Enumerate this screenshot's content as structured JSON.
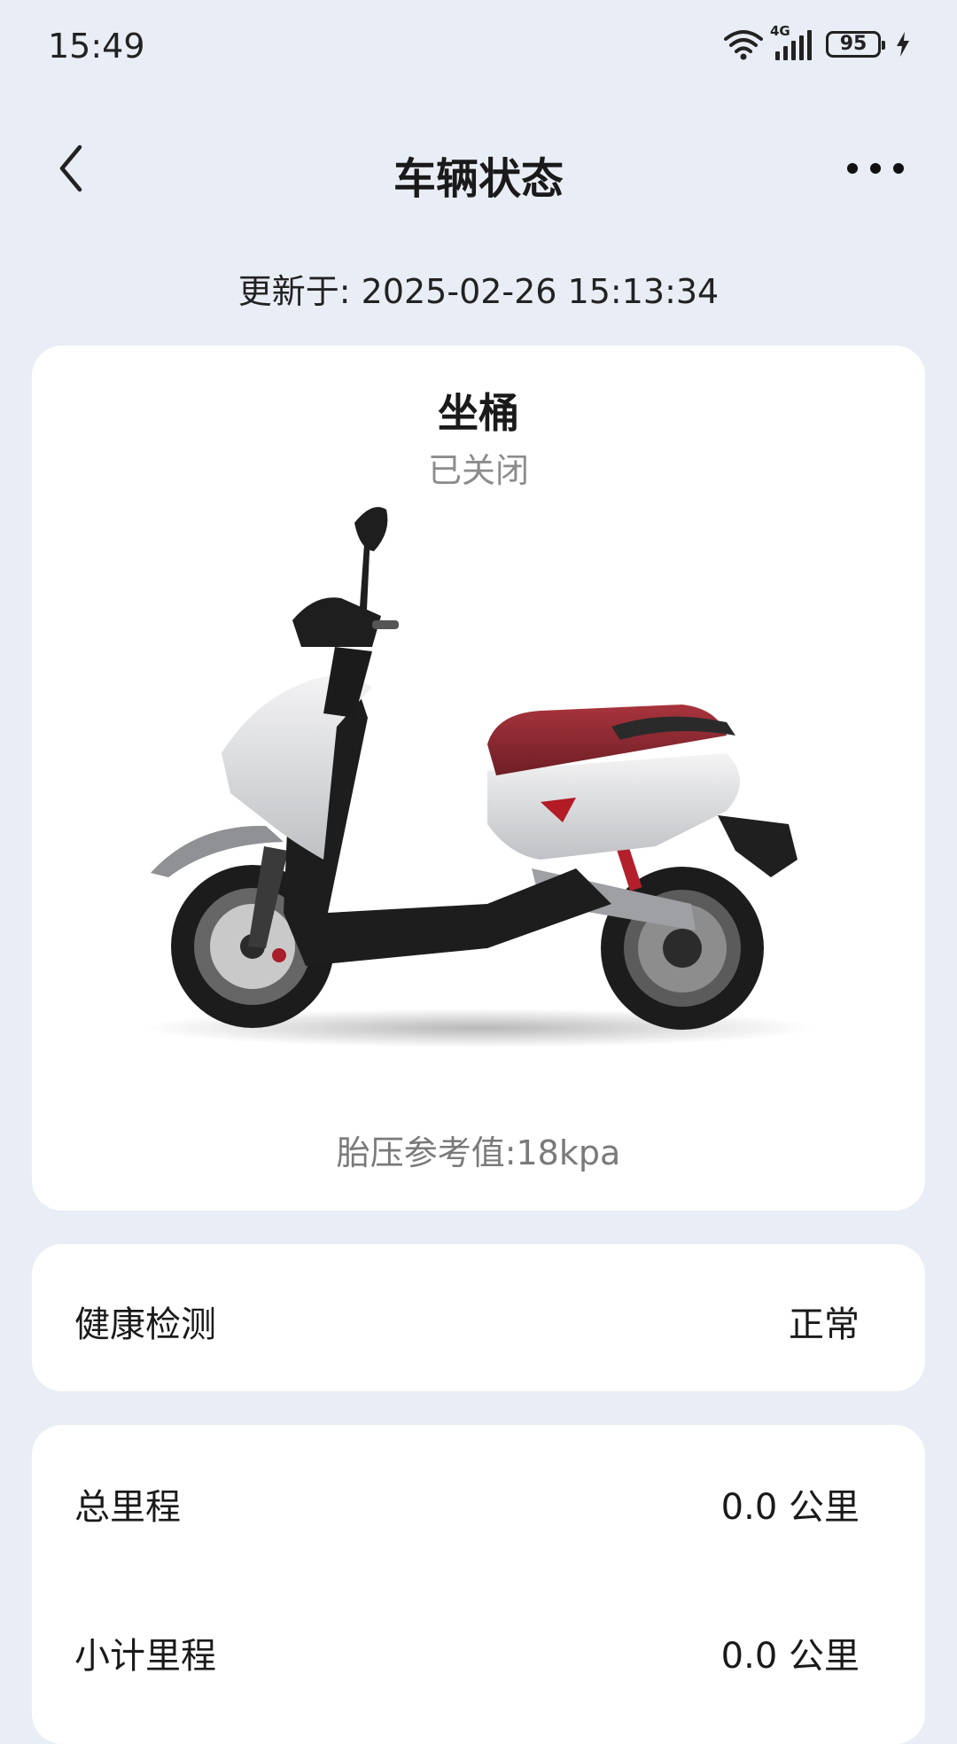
{
  "status_bar": {
    "time": "15:49",
    "network_type": "4G",
    "battery_level": "95"
  },
  "header": {
    "title": "车辆状态"
  },
  "update": {
    "text": "更新于: 2025-02-26 15:13:34"
  },
  "seat_card": {
    "title": "坐桶",
    "status": "已关闭",
    "tire_pressure": "胎压参考值:18kpa"
  },
  "health": {
    "label": "健康检测",
    "value": "正常"
  },
  "mileage": {
    "total_label": "总里程",
    "total_value": "0.0 公里",
    "trip_label": "小计里程",
    "trip_value": "0.0 公里"
  },
  "colors": {
    "background": "#e9edf5",
    "card": "#ffffff",
    "seat_red": "#8e2b33",
    "body_white": "#d9dadc"
  }
}
